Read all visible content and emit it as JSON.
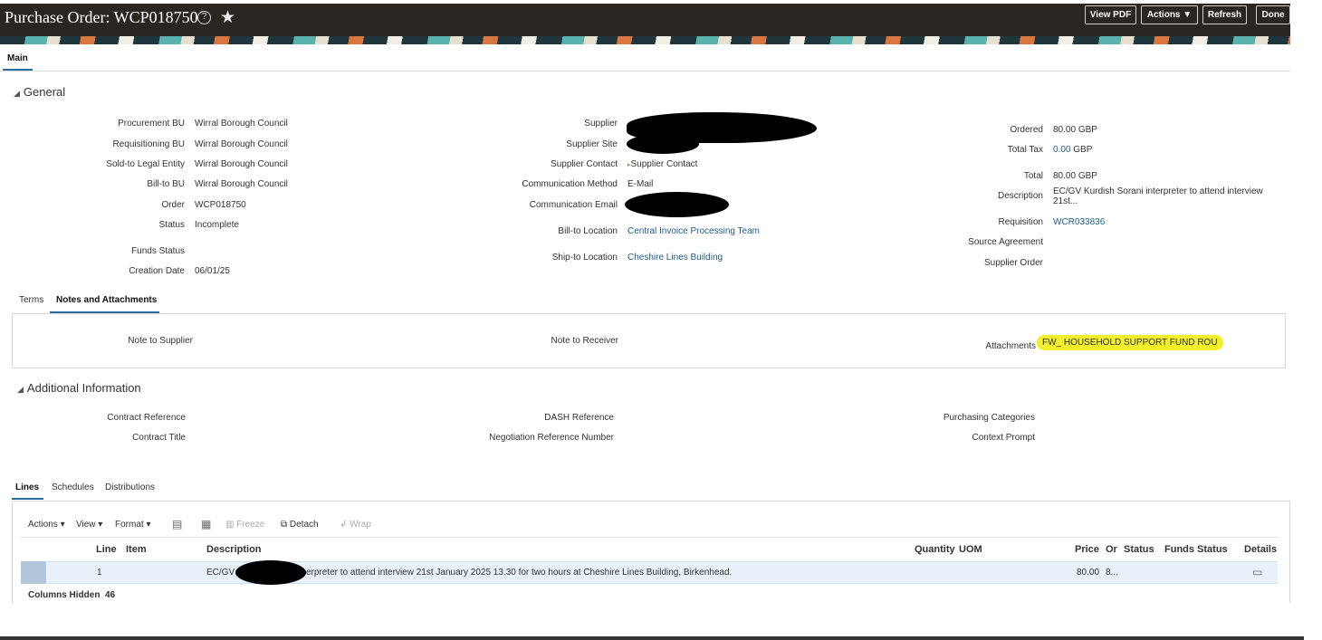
{
  "header": {
    "title": "Purchase Order: WCP018750",
    "buttons": {
      "view_pdf": "View PDF",
      "actions": "Actions",
      "refresh": "Refresh",
      "done": "Done"
    }
  },
  "main_tab": "Main",
  "general": {
    "title": "General",
    "col1": [
      {
        "label": "Procurement BU",
        "value": "Wirral Borough Council"
      },
      {
        "label": "Requisitioning BU",
        "value": "Wirral Borough Council"
      },
      {
        "label": "Sold-to Legal Entity",
        "value": "Wirral Borough Council"
      },
      {
        "label": "Bill-to BU",
        "value": "Wirral Borough Council"
      },
      {
        "label": "Order",
        "value": "WCP018750"
      },
      {
        "label": "Status",
        "value": "Incomplete"
      },
      {
        "label": "Funds Status",
        "value": ""
      },
      {
        "label": "Creation Date",
        "value": "06/01/25"
      }
    ],
    "col2": [
      {
        "label": "Supplier",
        "value": ""
      },
      {
        "label": "Supplier Site",
        "value": ""
      },
      {
        "label": "Supplier Contact",
        "value": "Supplier Contact"
      },
      {
        "label": "Communication Method",
        "value": "E-Mail"
      },
      {
        "label": "Communication Email",
        "value": ""
      },
      {
        "label": "Bill-to Location",
        "value": "Central Invoice Processing Team"
      },
      {
        "label": "Ship-to Location",
        "value": "Cheshire Lines Building"
      }
    ],
    "col3": [
      {
        "label": "Ordered",
        "value": "80.00",
        "currency": "GBP"
      },
      {
        "label": "Total Tax",
        "value": "0.00",
        "currency": "GBP"
      },
      {
        "label": "Total",
        "value": "80.00",
        "currency": "GBP"
      },
      {
        "label": "Description",
        "value": "EC/GV Kurdish Sorani interpreter to attend interview 21st..."
      },
      {
        "label": "Requisition",
        "value": "WCR033836"
      },
      {
        "label": "Source Agreement",
        "value": ""
      },
      {
        "label": "Supplier Order",
        "value": ""
      }
    ]
  },
  "subtabs": {
    "terms": "Terms",
    "notes": "Notes and Attachments"
  },
  "notes": {
    "note_to_supplier": "Note to Supplier",
    "note_to_receiver": "Note to Receiver",
    "attachments_label": "Attachments",
    "attachment": "FW_ HOUSEHOLD SUPPORT FUND ROU"
  },
  "additional": {
    "title": "Additional Information",
    "contract_reference": "Contract Reference",
    "contract_title": "Contract Title",
    "dash_reference": "DASH Reference",
    "negotiation_reference": "Negotiation Reference Number",
    "purchasing_categories": "Purchasing Categories",
    "context_prompt": "Context Prompt"
  },
  "lines_tabs": {
    "lines": "Lines",
    "schedules": "Schedules",
    "distributions": "Distributions"
  },
  "toolbar": {
    "actions": "Actions",
    "view": "View",
    "format": "Format",
    "freeze": "Freeze",
    "detach": "Detach",
    "wrap": "Wrap"
  },
  "table": {
    "headers": {
      "line": "Line",
      "item": "Item",
      "description": "Description",
      "quantity": "Quantity",
      "uom": "UOM",
      "price": "Price",
      "or": "Or",
      "status": "Status",
      "funds_status": "Funds Status",
      "details": "Details"
    },
    "rows": [
      {
        "line": "1",
        "desc_pre": "EC/GV",
        "desc_post": "erpreter to attend interview 21st January 2025 13.30 for two hours at Cheshire Lines Building, Birkenhead.",
        "price": "80.00",
        "or": "8..."
      }
    ],
    "columns_hidden_label": "Columns Hidden",
    "columns_hidden_count": "46"
  }
}
